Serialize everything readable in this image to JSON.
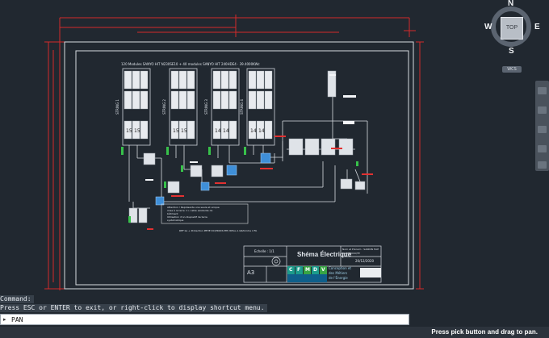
{
  "viewcube": {
    "north": "N",
    "south": "S",
    "east": "E",
    "west": "W",
    "face": "TOP",
    "wcs": "WCS"
  },
  "drawing": {
    "modules_header": "120 Modules SANYO HIT N230SE10 + 40 modules SANYO HIT 240HDE4 · 39.4000KWc",
    "string_labels": [
      "STRING 1",
      "STRING 2",
      "STRING 3",
      "STRING 4"
    ],
    "module_numbers": [
      "15",
      "15",
      "15",
      "15",
      "14",
      "14",
      "14",
      "14"
    ],
    "note_lines": [
      "Attention ! Représente une seule et unique",
      "mise à la terre => cable existante du",
      "bâtiment",
      "Utilisation d'un dispositif de terre",
      "systématique"
    ],
    "bottom_note": "REF ka + Protection PEHE DC/PRODUITE/ REGL A GRAS kha d FA",
    "title_block": {
      "title": "Shéma Électrique",
      "scale_label": "Echelle : 1/1",
      "format": "A3",
      "name_label": "Nom et Prénom : SANDIN HAE",
      "reference": "BARBEDOU/TE",
      "date": "20/12/2020",
      "company_letters": [
        "C",
        "F",
        "M",
        "D",
        "V"
      ],
      "company_line1": "Conception et",
      "company_line2": "des Métiers",
      "company_line3": "de l'Énergie"
    }
  },
  "command_history": [
    "Command:",
    "Press ESC or ENTER to exit, or right-click to display shortcut menu."
  ],
  "command_line": {
    "value": "PAN"
  },
  "status_bar": {
    "message": "Press pick button and drag to pan."
  }
}
